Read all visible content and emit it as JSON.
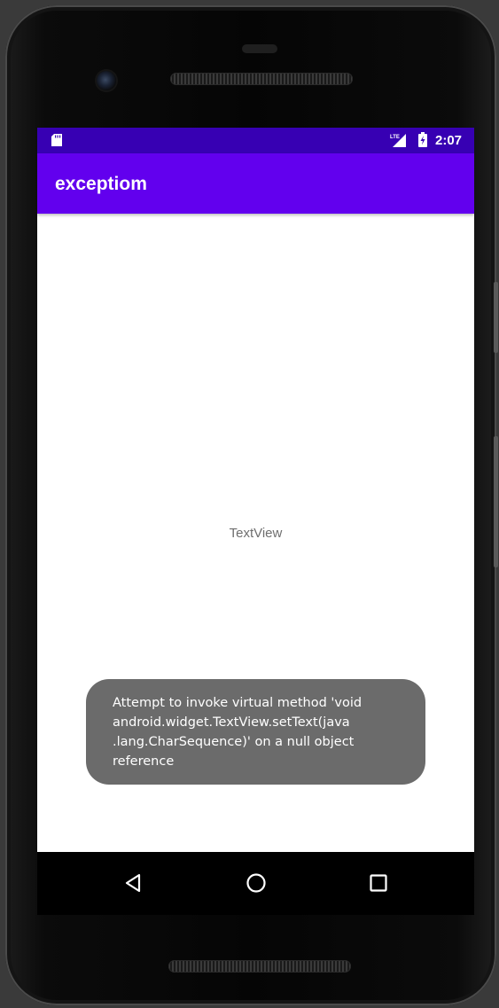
{
  "status_bar": {
    "time": "2:07",
    "network": "LTE",
    "icons": [
      "sd-card-icon",
      "lte-signal-icon",
      "battery-charging-icon"
    ],
    "background": "#3700b3"
  },
  "app_bar": {
    "title": "exceptiom",
    "background": "#6200ee"
  },
  "main": {
    "text_view": "TextView"
  },
  "toast": {
    "lines": [
      "Attempt to invoke virtual method 'void",
      "android.widget.TextView.setText(java",
      ".lang.CharSequence)' on a null object",
      "reference"
    ],
    "background": "#6b6b6b"
  },
  "nav_bar": {
    "buttons": [
      "back-icon",
      "home-icon",
      "recents-icon"
    ]
  }
}
